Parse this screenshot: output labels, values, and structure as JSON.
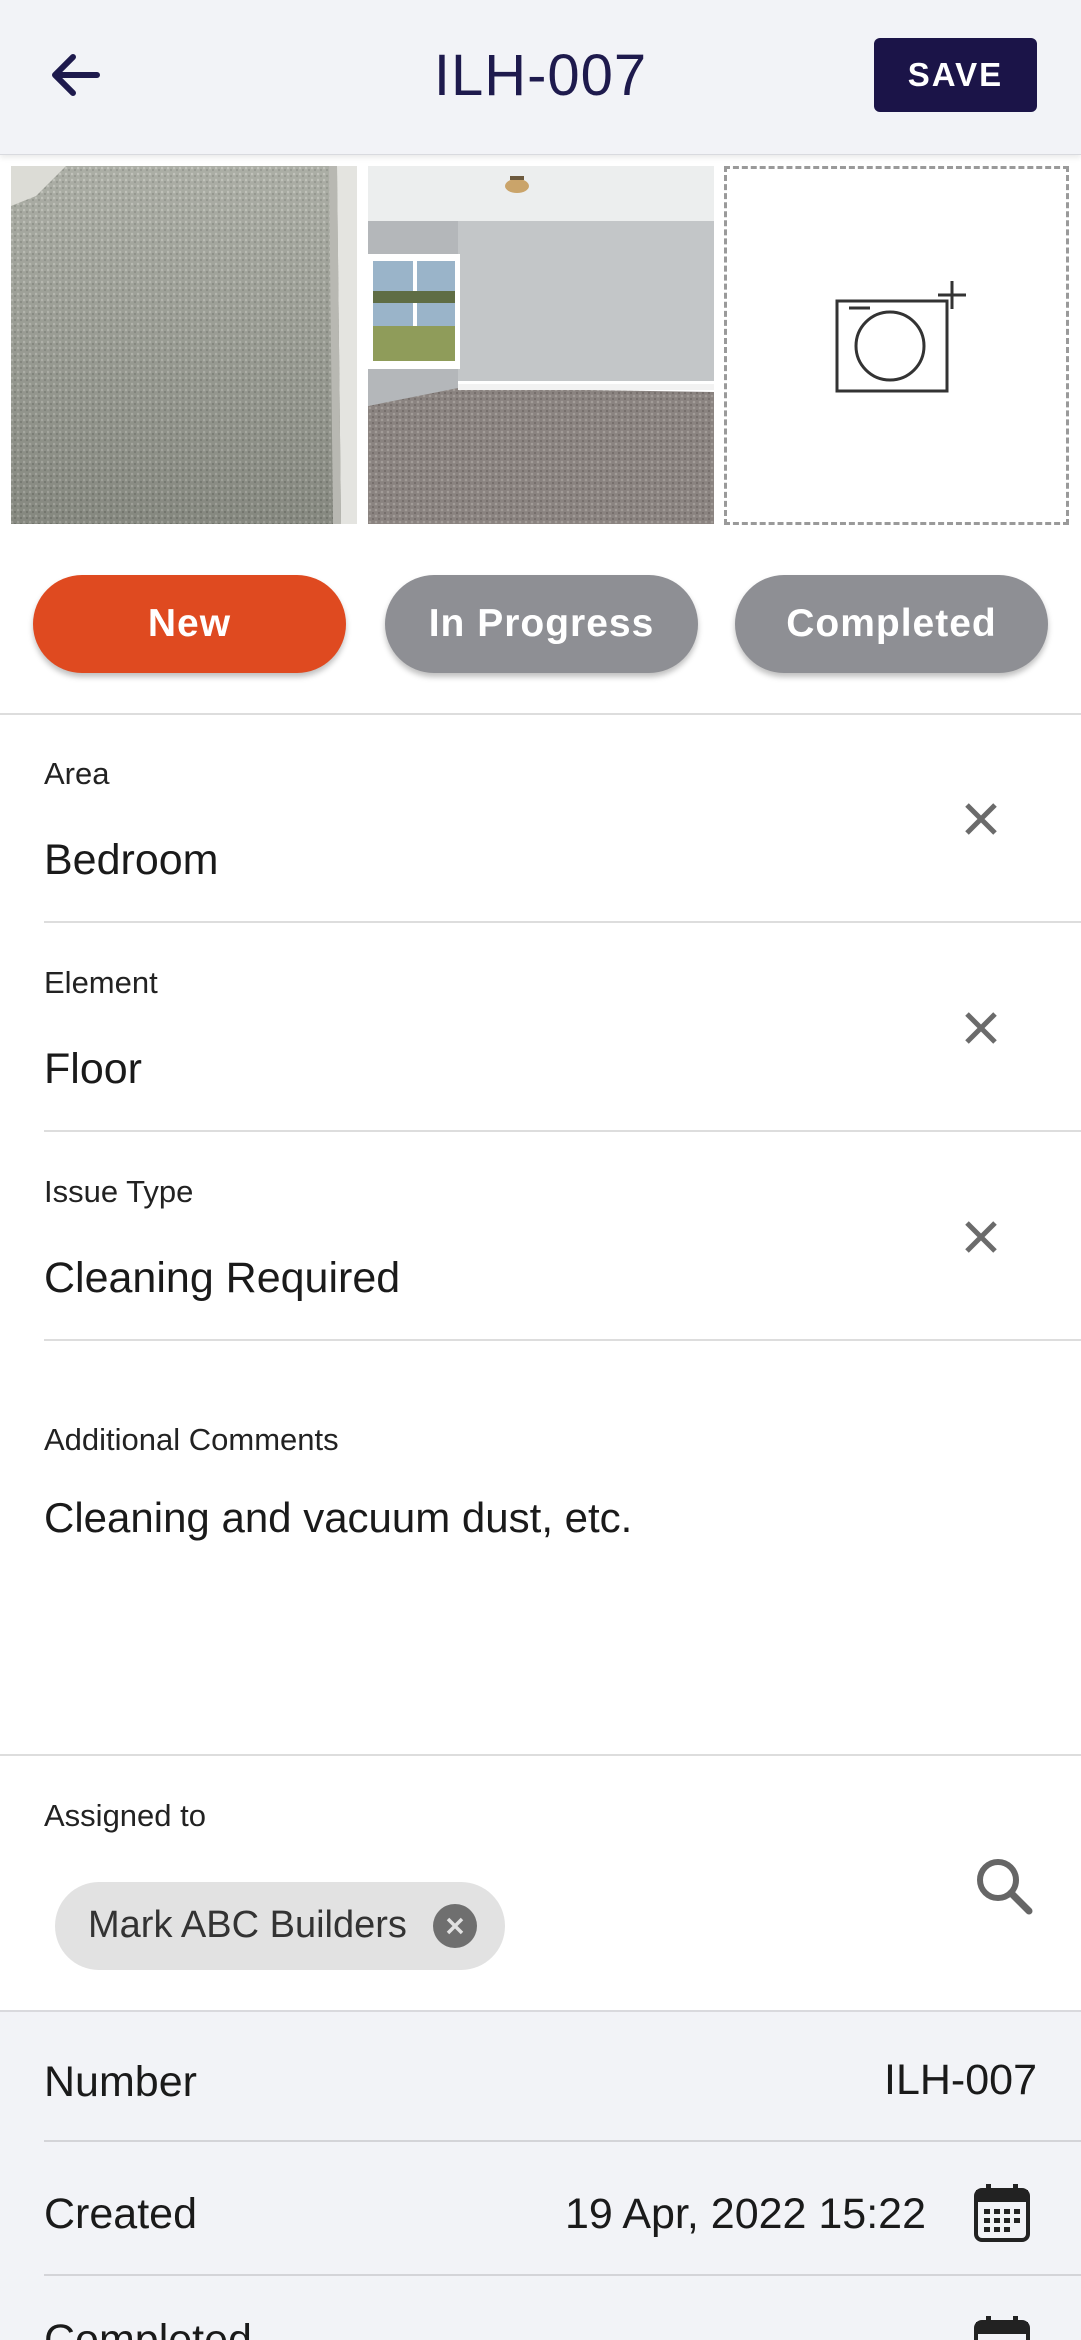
{
  "header": {
    "title": "ILH-007",
    "save_label": "SAVE"
  },
  "statuses": [
    {
      "label": "New",
      "active": true,
      "color": "#df4a20"
    },
    {
      "label": "In Progress",
      "active": false,
      "color": "#8e8f94"
    },
    {
      "label": "Completed",
      "active": false,
      "color": "#8e8f94"
    }
  ],
  "fields": {
    "area": {
      "label": "Area",
      "value": "Bedroom"
    },
    "element": {
      "label": "Element",
      "value": "Floor"
    },
    "issue_type": {
      "label": "Issue Type",
      "value": "Cleaning Required"
    },
    "comments": {
      "label": "Additional Comments",
      "value": "Cleaning and vacuum dust, etc."
    }
  },
  "assigned": {
    "label": "Assigned to",
    "chips": [
      "Mark ABC Builders"
    ]
  },
  "info": {
    "number": {
      "label": "Number",
      "value": "ILH-007"
    },
    "created": {
      "label": "Created",
      "value": "19 Apr, 2022 15:22"
    },
    "completed": {
      "label": "Completed"
    }
  },
  "colors": {
    "brand_dark": "#1b1448",
    "accent": "#df4a20",
    "muted": "#8e8f94"
  },
  "icons": [
    "back-arrow-icon",
    "add-photo-camera-icon",
    "close-icon",
    "search-icon",
    "calendar-icon"
  ]
}
